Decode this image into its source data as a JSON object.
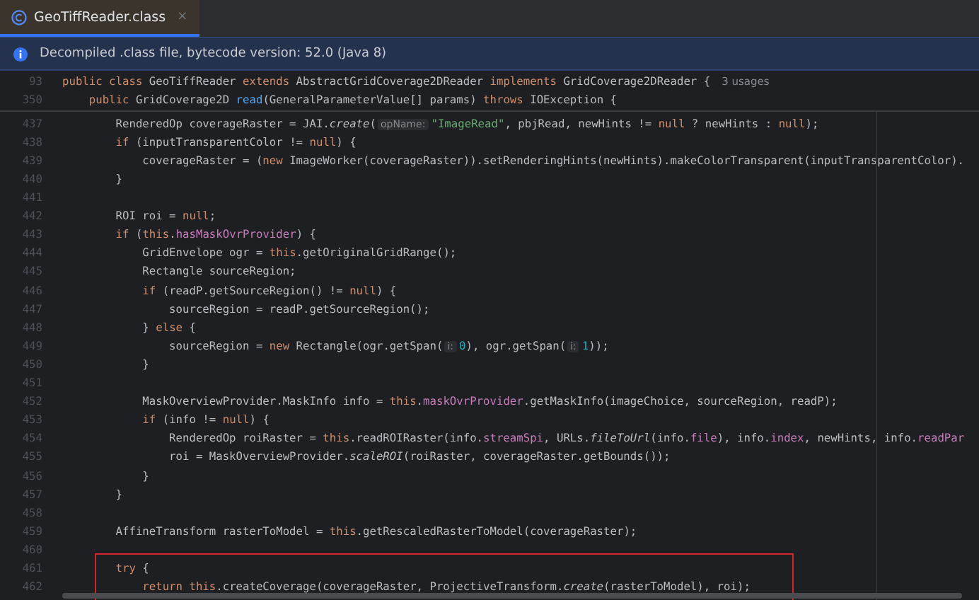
{
  "tab": {
    "title": "GeoTiffReader.class",
    "close": "×",
    "selected": true
  },
  "banner": {
    "text": "Decompiled .class file, bytecode version: 52.0 (Java 8)"
  },
  "sticky_lines": [
    {
      "number": "93",
      "tokens": [
        {
          "kind": "k",
          "text": "public class "
        },
        {
          "kind": "p",
          "text": "GeoTiffReader "
        },
        {
          "kind": "k",
          "text": "extends "
        },
        {
          "kind": "p",
          "text": "AbstractGridCoverage2DReader "
        },
        {
          "kind": "k",
          "text": "implements "
        },
        {
          "kind": "p",
          "text": "GridCoverage2DReader {"
        }
      ],
      "usages": "3 usages"
    },
    {
      "number": "350",
      "tokens": [
        {
          "kind": "k",
          "text": "    public "
        },
        {
          "kind": "p",
          "text": "GridCoverage2D "
        },
        {
          "kind": "m",
          "text": "read"
        },
        {
          "kind": "p",
          "text": "(GeneralParameterValue[] params) "
        },
        {
          "kind": "k",
          "text": "throws "
        },
        {
          "kind": "p",
          "text": "IOException {"
        }
      ]
    }
  ],
  "lines": [
    {
      "number": "437",
      "tokens": [
        {
          "kind": "p",
          "text": "        RenderedOp coverageRaster = JAI."
        },
        {
          "kind": "i",
          "text": "create"
        },
        {
          "kind": "p",
          "text": "("
        },
        {
          "kind": "h",
          "text": "opName:"
        },
        {
          "kind": "s",
          "text": "\"ImageRead\""
        },
        {
          "kind": "p",
          "text": ", pbjRead, newHints != "
        },
        {
          "kind": "k",
          "text": "null"
        },
        {
          "kind": "p",
          "text": " ? newHints : "
        },
        {
          "kind": "k",
          "text": "null"
        },
        {
          "kind": "p",
          "text": ");"
        }
      ]
    },
    {
      "number": "438",
      "tokens": [
        {
          "kind": "k",
          "text": "        if"
        },
        {
          "kind": "p",
          "text": " (inputTransparentColor != "
        },
        {
          "kind": "k",
          "text": "null"
        },
        {
          "kind": "p",
          "text": ") {"
        }
      ]
    },
    {
      "number": "439",
      "tokens": [
        {
          "kind": "p",
          "text": "            coverageRaster = ("
        },
        {
          "kind": "k",
          "text": "new"
        },
        {
          "kind": "p",
          "text": " ImageWorker(coverageRaster)).setRenderingHints(newHints).makeColorTransparent(inputTransparentColor)."
        }
      ]
    },
    {
      "number": "440",
      "tokens": [
        {
          "kind": "p",
          "text": "        }"
        }
      ]
    },
    {
      "number": "441"
    },
    {
      "number": "442",
      "tokens": [
        {
          "kind": "p",
          "text": "        ROI roi = "
        },
        {
          "kind": "k",
          "text": "null"
        },
        {
          "kind": "p",
          "text": ";"
        }
      ]
    },
    {
      "number": "443",
      "tokens": [
        {
          "kind": "k",
          "text": "        if"
        },
        {
          "kind": "p",
          "text": " ("
        },
        {
          "kind": "k",
          "text": "this"
        },
        {
          "kind": "p",
          "text": "."
        },
        {
          "kind": "f",
          "text": "hasMaskOvrProvider"
        },
        {
          "kind": "p",
          "text": ") {"
        }
      ]
    },
    {
      "number": "444",
      "tokens": [
        {
          "kind": "p",
          "text": "            GridEnvelope ogr = "
        },
        {
          "kind": "k",
          "text": "this"
        },
        {
          "kind": "p",
          "text": ".getOriginalGridRange();"
        }
      ]
    },
    {
      "number": "445",
      "tokens": [
        {
          "kind": "p",
          "text": "            Rectangle sourceRegion;"
        }
      ]
    },
    {
      "number": "446",
      "tokens": [
        {
          "kind": "k",
          "text": "            if"
        },
        {
          "kind": "p",
          "text": " (readP.getSourceRegion() != "
        },
        {
          "kind": "k",
          "text": "null"
        },
        {
          "kind": "p",
          "text": ") {"
        }
      ]
    },
    {
      "number": "447",
      "tokens": [
        {
          "kind": "p",
          "text": "                sourceRegion = readP.getSourceRegion();"
        }
      ]
    },
    {
      "number": "448",
      "tokens": [
        {
          "kind": "p",
          "text": "            } "
        },
        {
          "kind": "k",
          "text": "else"
        },
        {
          "kind": "p",
          "text": " {"
        }
      ]
    },
    {
      "number": "449",
      "tokens": [
        {
          "kind": "p",
          "text": "                sourceRegion = "
        },
        {
          "kind": "k",
          "text": "new"
        },
        {
          "kind": "p",
          "text": " Rectangle(ogr.getSpan("
        },
        {
          "kind": "h",
          "text": "i:"
        },
        {
          "kind": "n",
          "text": "0"
        },
        {
          "kind": "p",
          "text": "), ogr.getSpan("
        },
        {
          "kind": "h",
          "text": "i:"
        },
        {
          "kind": "n",
          "text": "1"
        },
        {
          "kind": "p",
          "text": "));"
        }
      ]
    },
    {
      "number": "450",
      "tokens": [
        {
          "kind": "p",
          "text": "            }"
        }
      ]
    },
    {
      "number": "451"
    },
    {
      "number": "452",
      "tokens": [
        {
          "kind": "p",
          "text": "            MaskOverviewProvider.MaskInfo info = "
        },
        {
          "kind": "k",
          "text": "this"
        },
        {
          "kind": "p",
          "text": "."
        },
        {
          "kind": "f",
          "text": "maskOvrProvider"
        },
        {
          "kind": "p",
          "text": ".getMaskInfo(imageChoice, sourceRegion, readP);"
        }
      ]
    },
    {
      "number": "453",
      "tokens": [
        {
          "kind": "k",
          "text": "            if"
        },
        {
          "kind": "p",
          "text": " (info != "
        },
        {
          "kind": "k",
          "text": "null"
        },
        {
          "kind": "p",
          "text": ") {"
        }
      ]
    },
    {
      "number": "454",
      "tokens": [
        {
          "kind": "p",
          "text": "                RenderedOp roiRaster = "
        },
        {
          "kind": "k",
          "text": "this"
        },
        {
          "kind": "p",
          "text": ".readROIRaster(info."
        },
        {
          "kind": "f",
          "text": "streamSpi"
        },
        {
          "kind": "p",
          "text": ", URLs."
        },
        {
          "kind": "i",
          "text": "fileToUrl"
        },
        {
          "kind": "p",
          "text": "(info."
        },
        {
          "kind": "f",
          "text": "file"
        },
        {
          "kind": "p",
          "text": "), info."
        },
        {
          "kind": "f",
          "text": "index"
        },
        {
          "kind": "p",
          "text": ", newHints, info."
        },
        {
          "kind": "f",
          "text": "readPar"
        }
      ]
    },
    {
      "number": "455",
      "tokens": [
        {
          "kind": "p",
          "text": "                roi = MaskOverviewProvider."
        },
        {
          "kind": "i",
          "text": "scaleROI"
        },
        {
          "kind": "p",
          "text": "(roiRaster, coverageRaster.getBounds());"
        }
      ]
    },
    {
      "number": "456",
      "tokens": [
        {
          "kind": "p",
          "text": "            }"
        }
      ]
    },
    {
      "number": "457",
      "tokens": [
        {
          "kind": "p",
          "text": "        }"
        }
      ]
    },
    {
      "number": "458"
    },
    {
      "number": "459",
      "tokens": [
        {
          "kind": "p",
          "text": "        AffineTransform rasterToModel = "
        },
        {
          "kind": "k",
          "text": "this"
        },
        {
          "kind": "p",
          "text": ".getRescaledRasterToModel(coverageRaster);"
        }
      ]
    },
    {
      "number": "460"
    },
    {
      "number": "461",
      "tokens": [
        {
          "kind": "k",
          "text": "        try"
        },
        {
          "kind": "p",
          "text": " {"
        }
      ]
    },
    {
      "number": "462",
      "tokens": [
        {
          "kind": "k",
          "text": "            return this"
        },
        {
          "kind": "p",
          "text": ".createCoverage(coverageRaster, ProjectiveTransform."
        },
        {
          "kind": "i",
          "text": "create"
        },
        {
          "kind": "p",
          "text": "(rasterToModel), roi);"
        }
      ]
    }
  ]
}
